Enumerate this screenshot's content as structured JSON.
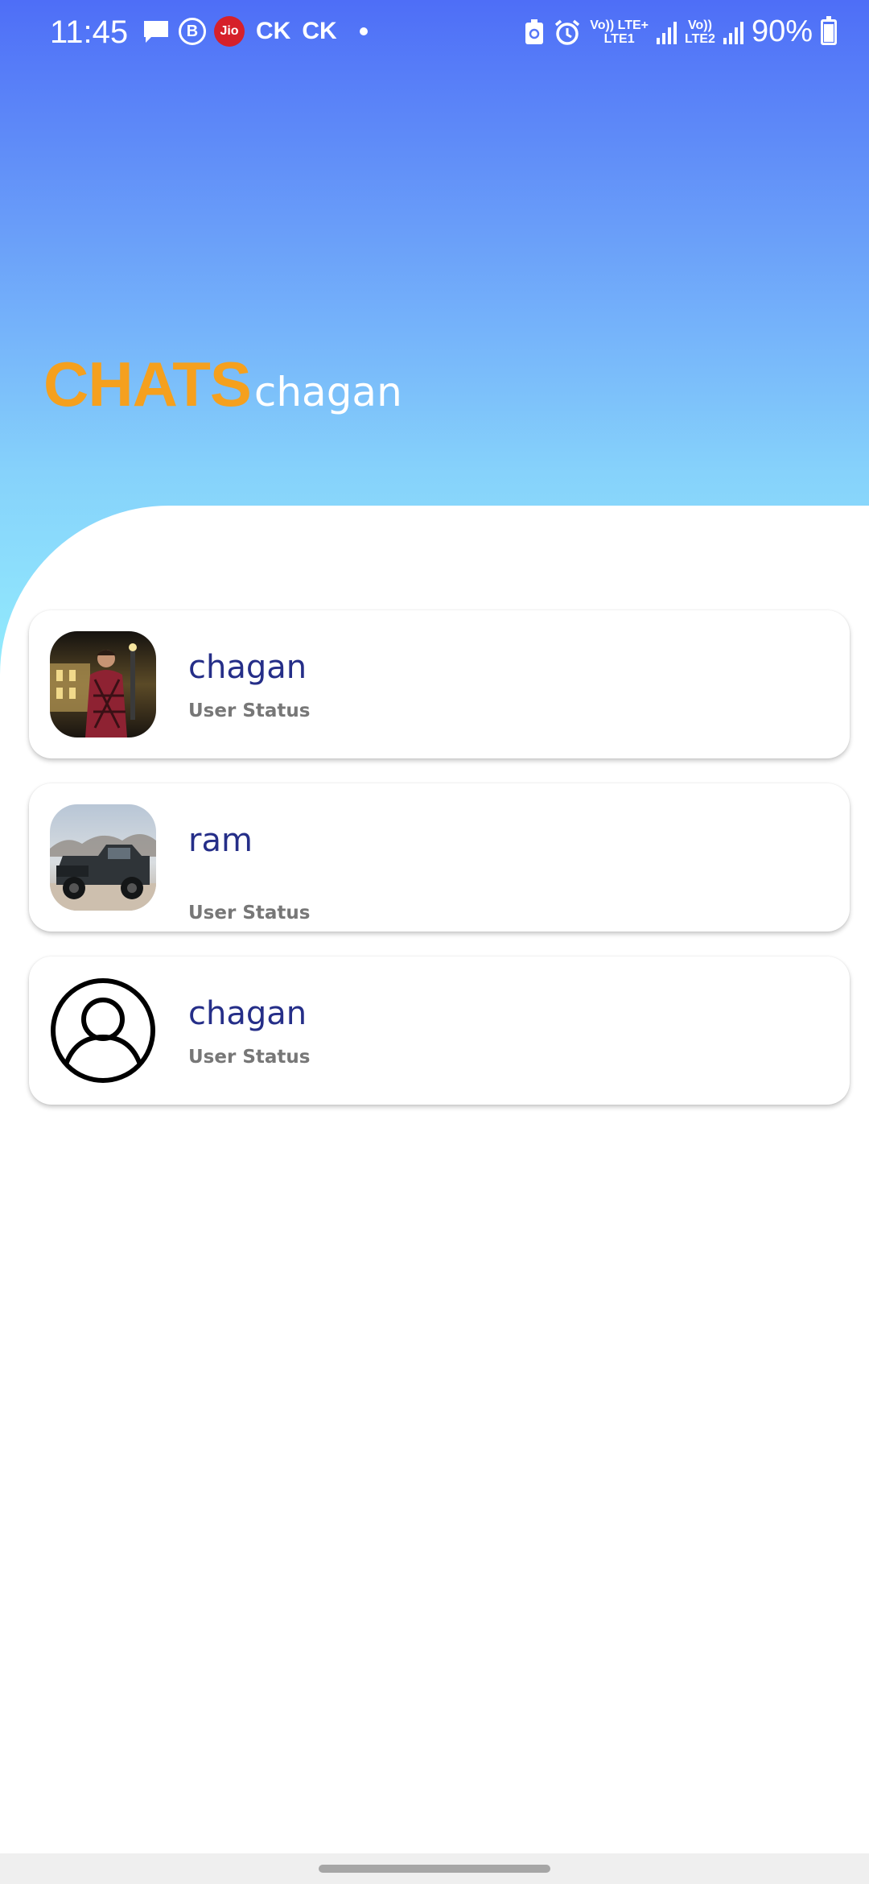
{
  "status_bar": {
    "time": "11:45",
    "left_icons": [
      "message-icon",
      "b-icon",
      "jio-icon"
    ],
    "jio_text": "Jio",
    "b_text": "B",
    "ck1": "CK",
    "ck2": "CK",
    "network_1_top": "Vo)) LTE+",
    "network_1_bottom": "LTE1",
    "network_2_top": "Vo))",
    "network_2_bottom": "LTE2",
    "battery_percent": "90%"
  },
  "header": {
    "title": "CHATS",
    "username": "chagan",
    "title_color": "#f5a01e"
  },
  "chats": [
    {
      "name": "chagan",
      "status": "User Status",
      "avatar": "person-photo"
    },
    {
      "name": "ram",
      "status": "User Status",
      "avatar": "truck-photo"
    },
    {
      "name": "chagan",
      "status": "User Status",
      "avatar": "default-user-icon"
    }
  ],
  "colors": {
    "name_color": "#252e88",
    "status_color": "#777777",
    "gradient_top": "#4e6ef7",
    "gradient_bottom": "#93ecfd"
  }
}
